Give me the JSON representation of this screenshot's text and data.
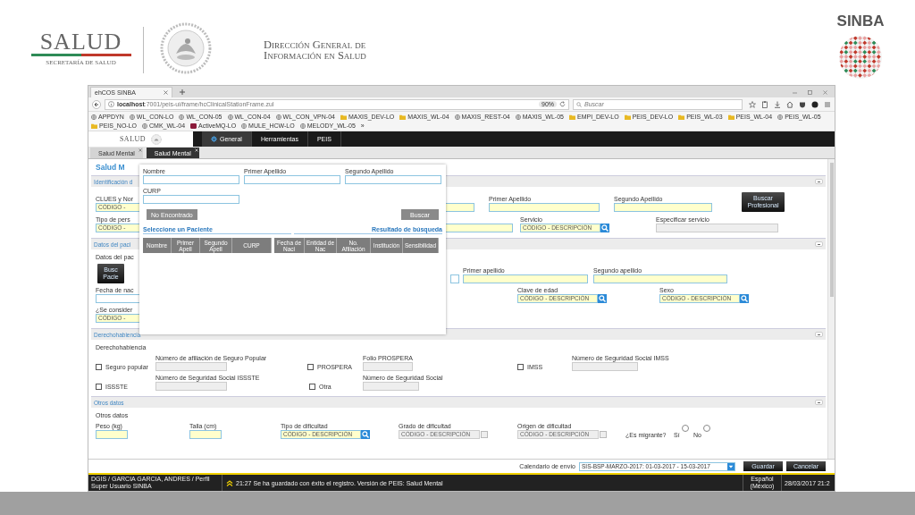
{
  "header": {
    "ministry": "SALUD",
    "ministry_sub": "SECRETARÍA DE SALUD",
    "office_lines": [
      "Dirección General de",
      "Información en Salud"
    ],
    "brand": "SINBA"
  },
  "browser": {
    "tab_title": "ehCOS SINBA",
    "url_host": "localhost",
    "url_path": ":7001/peis-ui/frame/hcClinicalStationFrame.zul",
    "zoom": "90%",
    "search_placeholder": "Buscar",
    "bookmarks": [
      {
        "label": "APPDYN",
        "kind": "globe"
      },
      {
        "label": "WL_CON-LO",
        "kind": "globe"
      },
      {
        "label": "WL_CON-05",
        "kind": "globe"
      },
      {
        "label": "WL_CON-04",
        "kind": "globe"
      },
      {
        "label": "WL_CON_VPN-04",
        "kind": "globe"
      },
      {
        "label": "MAXIS_DEV-LO",
        "kind": "folder"
      },
      {
        "label": "MAXIS_WL-04",
        "kind": "folder"
      },
      {
        "label": "MAXIS_REST-04",
        "kind": "globe"
      },
      {
        "label": "MAXIS_WL-05",
        "kind": "globe"
      },
      {
        "label": "EMPI_DEV-LO",
        "kind": "folder"
      },
      {
        "label": "PEIS_DEV-LO",
        "kind": "folder"
      },
      {
        "label": "PEIS_WL-03",
        "kind": "folder"
      },
      {
        "label": "PEIS_WL-04",
        "kind": "folder"
      },
      {
        "label": "PEIS_WL-05",
        "kind": "globe"
      },
      {
        "label": "PEIS_NO-LO",
        "kind": "folder"
      },
      {
        "label": "CMK_WL-04",
        "kind": "globe"
      },
      {
        "label": "ActiveMQ-LO",
        "kind": "app"
      },
      {
        "label": "MULE_HCW-LO",
        "kind": "globe"
      },
      {
        "label": "MELODY_WL-05",
        "kind": "globe"
      }
    ],
    "more": "»"
  },
  "app": {
    "logo": "SALUD",
    "menu": [
      {
        "label": "General",
        "selected": true
      },
      {
        "label": "Herramientas",
        "selected": false
      },
      {
        "label": "PEIS",
        "selected": false
      }
    ],
    "tabs": [
      {
        "label": "Salud Mental",
        "selected": false
      },
      {
        "label": "Salud Mental",
        "selected": true
      }
    ],
    "page_title": "Salud M",
    "sections": [
      {
        "title": "Identificación d",
        "rows": [
          [
            {
              "kind": "input",
              "label": "CLUES y Nor",
              "value": "CÓDIGO -"
            },
            {
              "kind": "input"
            },
            {
              "kind": "input",
              "label": "Primer Apellido"
            },
            {
              "kind": "input",
              "label": "Segundo Apellido"
            },
            {
              "kind": "button",
              "label": "Buscar Profesional"
            }
          ],
          [
            {
              "kind": "input",
              "label": "Tipo de pers",
              "value": "CÓDIGO -"
            },
            {
              "kind": "input"
            },
            {
              "kind": "lookup",
              "label": "Servicio",
              "value": "CÓDIGO - DESCRIPCIÓN"
            },
            {
              "kind": "disabled",
              "label": "Especificar servicio"
            }
          ]
        ]
      },
      {
        "title": "Datos del paci",
        "rows": [
          [
            {
              "kind": "caption",
              "label": "Datos del pac"
            }
          ],
          [
            {
              "kind": "button",
              "label": "Busc Pacie"
            },
            {
              "kind": "plain"
            },
            {
              "kind": "input",
              "label": "Primer apellido"
            },
            {
              "kind": "input",
              "label": "Segundo apellido"
            }
          ],
          [
            {
              "kind": "plain",
              "label": "Fecha de nac"
            },
            {
              "kind": "lookup",
              "label": "Clave de edad",
              "value": "CÓDIGO - DESCRIPCIÓN"
            },
            {
              "kind": "lookup",
              "label": "Sexo",
              "value": "CÓDIGO - DESCRIPCIÓN"
            }
          ],
          [
            {
              "kind": "input",
              "label": "¿Se consider",
              "value": "CÓDIGO -"
            }
          ]
        ]
      },
      {
        "title": "Derechohabiencia",
        "rows": [
          [
            {
              "kind": "caption",
              "label": "Derechohabiencia"
            }
          ],
          [
            {
              "kind": "checkbox",
              "label": "Seguro popular",
              "checked": false
            },
            {
              "kind": "disabled",
              "label": "Número de afiliación de Seguro Popular"
            },
            {
              "kind": "checkbox",
              "label": "PROSPERA",
              "checked": false
            },
            {
              "kind": "disabled",
              "label": "Folio PROSPERA"
            },
            {
              "kind": "checkbox",
              "label": "IMSS",
              "checked": false
            },
            {
              "kind": "disabled",
              "label": "Número de Seguridad Social IMSS"
            }
          ],
          [
            {
              "kind": "checkbox",
              "label": "ISSSTE",
              "checked": false
            },
            {
              "kind": "disabled",
              "label": "Número de Seguridad Social ISSSTE"
            },
            {
              "kind": "checkbox",
              "label": "Otra",
              "checked": false
            },
            {
              "kind": "disabled",
              "label": "Número de Seguridad Social"
            }
          ]
        ]
      },
      {
        "title": "Otros datos",
        "rows": [
          [
            {
              "kind": "caption",
              "label": "Otros datos"
            }
          ],
          [
            {
              "kind": "input",
              "label": "Peso (kg)"
            },
            {
              "kind": "input",
              "label": "Talla (cm)"
            },
            {
              "kind": "lookup",
              "label": "Tipo de dificultad",
              "value": "CÓDIGO - DESCRIPCIÓN"
            },
            {
              "kind": "lookup-disabled",
              "label": "Grado de dificultad",
              "value": "CÓDIGO - DESCRIPCIÓN"
            },
            {
              "kind": "lookup-disabled",
              "label": "Origen de dificultad",
              "value": "CÓDIGO - DESCRIPCIÓN"
            },
            {
              "kind": "caption",
              "label": "¿Es migrante?"
            },
            {
              "kind": "radio",
              "label": "Sí",
              "selected": false
            },
            {
              "kind": "radio",
              "label": "No",
              "selected": false
            }
          ]
        ]
      }
    ]
  },
  "search_dialog": {
    "fields": [
      {
        "label": "Nombre"
      },
      {
        "label": "Primer Apellido"
      },
      {
        "label": "Segundo Apellido"
      },
      {
        "label": "CURP"
      }
    ],
    "buttons": [
      {
        "label": "No Encontrado",
        "disabled": true
      },
      {
        "label": "Buscar",
        "disabled": true
      }
    ],
    "left_caption": "Seleccione un Paciente",
    "right_caption": "Resultado de búsqueda",
    "columns": [
      "Nombre",
      "Primer Apell",
      "Segundo Apell",
      "CURP",
      "Fecha de Naci",
      "Entidad de Nac",
      "No. Afiliación",
      "Institución",
      "Sensibilidad"
    ]
  },
  "footer": {
    "calendar_label": "Calendario de envío",
    "calendar_value": "SIS-BSP-MARZO-2017: 01-03-2017 - 15-03-2017",
    "buttons": [
      "Guardar",
      "Cancelar"
    ]
  },
  "status_bar": {
    "user": "DGIS / GARCIA GARCIA, ANDRES / Perfil Super Usuario SINBA",
    "message": "21:27 Se ha guardado con éxito el registro. Versión de PEIS: Salud Mental",
    "locale": "Español (México)",
    "datetime": "28/03/2017 21:2"
  }
}
